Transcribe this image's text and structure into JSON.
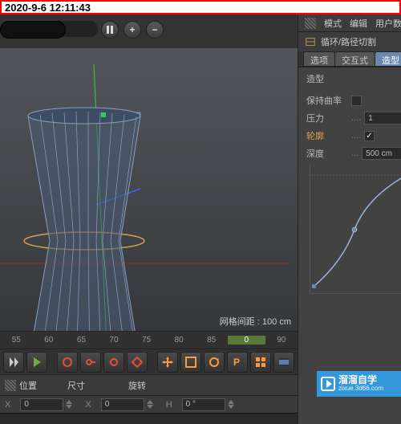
{
  "timestamp": "2020-9-6 12:11:43",
  "viewport": {
    "pause_icon": "pause",
    "plus_icon": "+",
    "minus_icon": "−",
    "grid_label": "网格间距 : 100 cm"
  },
  "timeline": {
    "frames": [
      "55",
      "60",
      "65",
      "70",
      "75",
      "80",
      "85",
      "90"
    ],
    "highlighted": "0"
  },
  "coord": {
    "pos_label": "位置",
    "size_label": "尺寸",
    "rot_label": "旋转",
    "x_label": "X",
    "x_val": "0",
    "x_size": "0",
    "h_label": "H",
    "h_val": "0 °"
  },
  "inspector": {
    "menu": {
      "mode": "模式",
      "edit": "编辑",
      "user": "用户数"
    },
    "title": "循环/路径切割",
    "tabs": {
      "options": "选项",
      "interact": "交互式",
      "shape": "造型"
    },
    "section_title": "造型",
    "props": {
      "keep_curv": {
        "label": "保持曲率",
        "checked": false
      },
      "pressure": {
        "label": "压力",
        "value": "1"
      },
      "contour": {
        "label": "轮廓",
        "checked": true
      },
      "depth": {
        "label": "深度",
        "value": "500 cm"
      }
    }
  },
  "watermark": {
    "zh": "溜溜自学",
    "url": "zixue.3d66.com"
  }
}
